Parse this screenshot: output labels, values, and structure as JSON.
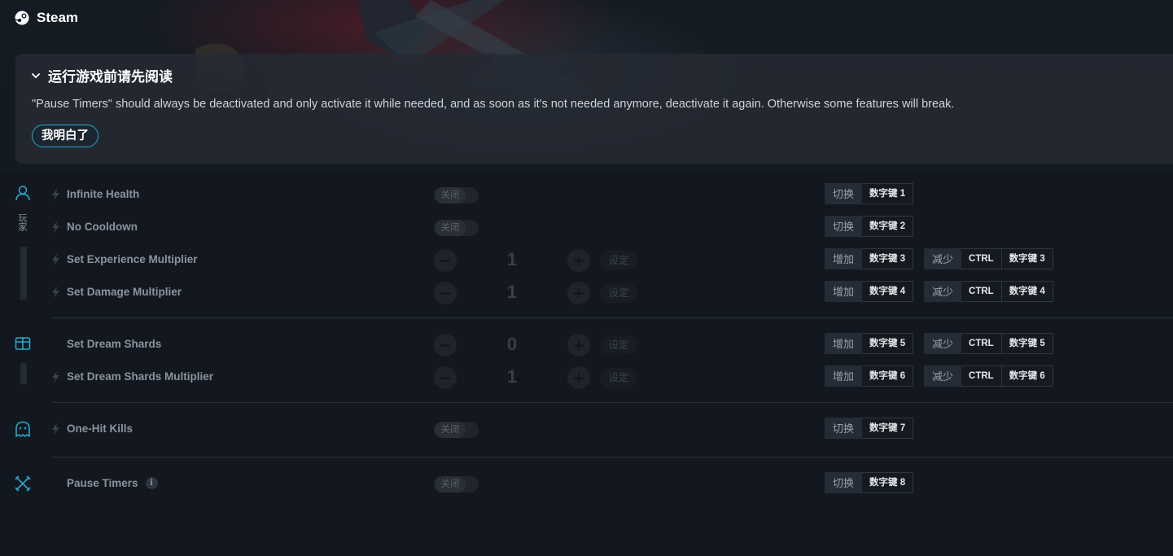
{
  "app": {
    "name": "Steam"
  },
  "notice": {
    "title": "运行游戏前请先阅读",
    "text": "\"Pause Timers\" should always be deactivated and only activate it while needed, and as soon as it's not needed anymore, deactivate it again. Otherwise some features will break.",
    "ack_label": "我明白了"
  },
  "categories": {
    "player": {
      "icon": "person-icon",
      "label": "玩家"
    },
    "inventory": {
      "icon": "chest-icon"
    },
    "enemies": {
      "icon": "ghost-icon"
    },
    "game": {
      "icon": "crossed-swords-icon"
    }
  },
  "common": {
    "toggle_off": "关闭",
    "apply": "设定",
    "toggle_action": "切换",
    "increase_action": "增加",
    "decrease_action": "减少",
    "ctrl": "CTRL"
  },
  "rows": [
    {
      "label": "Infinite Health",
      "key1": "数字键 1"
    },
    {
      "label": "No Cooldown",
      "key1": "数字键 2"
    },
    {
      "label": "Set Experience Multiplier",
      "value": "1",
      "key1": "数字键 3",
      "key2": "数字键 3"
    },
    {
      "label": "Set Damage Multiplier",
      "value": "1",
      "key1": "数字键 4",
      "key2": "数字键 4"
    },
    {
      "label": "Set Dream Shards",
      "value": "0",
      "key1": "数字键 5",
      "key2": "数字键 5"
    },
    {
      "label": "Set Dream Shards Multiplier",
      "value": "1",
      "key1": "数字键 6",
      "key2": "数字键 6"
    },
    {
      "label": "One-Hit Kills",
      "key1": "数字键 7"
    },
    {
      "label": "Pause Timers",
      "key1": "数字键 8"
    }
  ],
  "colors": {
    "accent": "#2aa8c9",
    "background": "#131820",
    "panel": "#252a33"
  }
}
